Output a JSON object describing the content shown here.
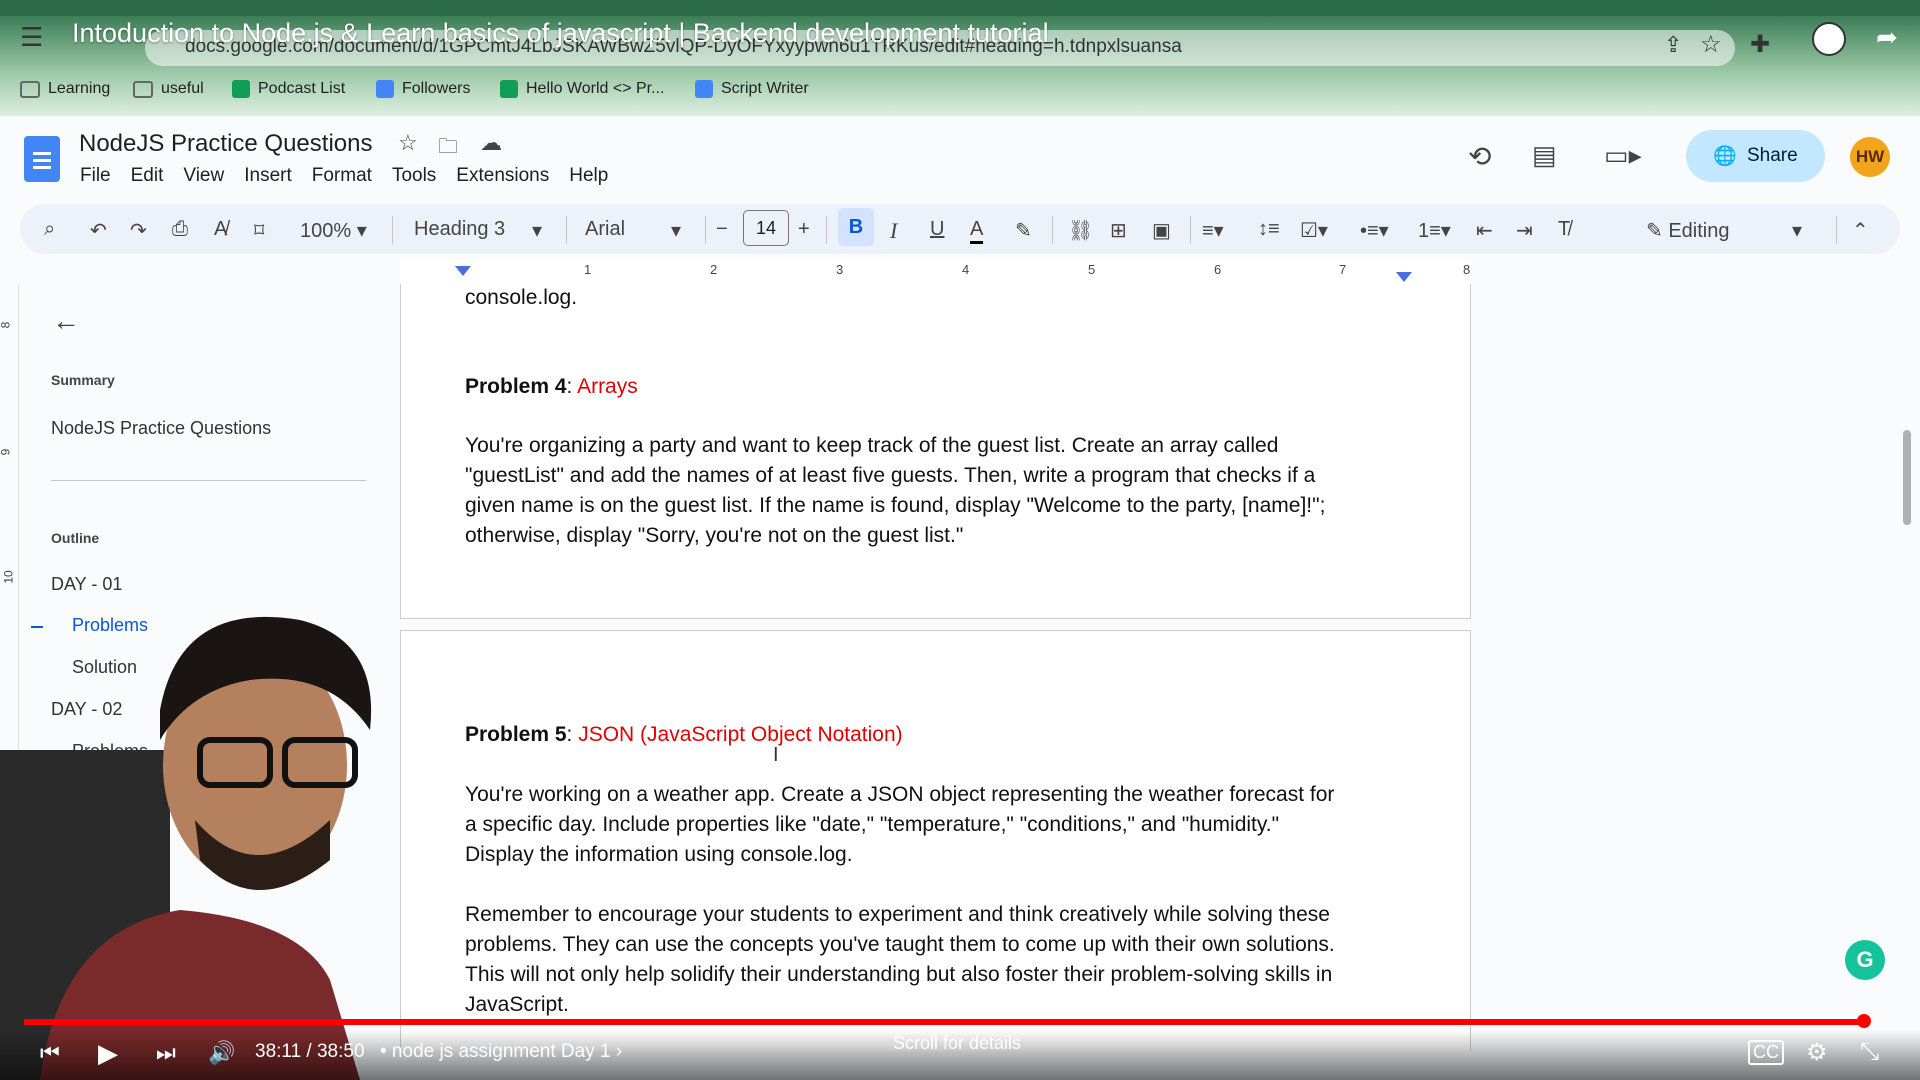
{
  "video": {
    "title": "Intoduction to Node.js & Learn basics of javascript | Backend development tutorial",
    "time": "38:11 / 38:50",
    "chapter": "• node js assignment Day 1 ›",
    "scroll_hint": "Scroll for details",
    "progress_fraction": 0.983
  },
  "browser": {
    "url": "docs.google.com/document/d/1GPCmtJ4LbJSKAWBwZ5vlQP-DyOFYxyypwn6u1TRKus/edit#heading=h.tdnpxlsuansa",
    "bookmarks": [
      {
        "label": "Learning",
        "color": "#7a7a7a"
      },
      {
        "label": "useful",
        "color": "#7a7a7a"
      },
      {
        "label": "Podcast List",
        "color": "#0f9d58"
      },
      {
        "label": "Followers",
        "color": "#4285f4"
      },
      {
        "label": "Hello World <> Pr...",
        "color": "#0f9d58"
      },
      {
        "label": "Script Writer",
        "color": "#4285f4"
      }
    ]
  },
  "docs": {
    "title": "NodeJS Practice Questions",
    "menu": [
      "File",
      "Edit",
      "View",
      "Insert",
      "Format",
      "Tools",
      "Extensions",
      "Help"
    ],
    "share_label": "Share",
    "avatar": "HW",
    "toolbar": {
      "zoom": "100%",
      "style": "Heading 3",
      "font": "Arial",
      "font_size": "14",
      "mode": "Editing"
    },
    "ruler_numbers": [
      "1",
      "2",
      "3",
      "4",
      "5",
      "6",
      "7",
      "8"
    ],
    "vruler_numbers": [
      "8",
      "9",
      "10"
    ]
  },
  "sidebar": {
    "summary_label": "Summary",
    "summary_text": "NodeJS Practice Questions",
    "outline_label": "Outline",
    "items": [
      {
        "label": "DAY - 01"
      },
      {
        "label": "Problems"
      },
      {
        "label": "Solution"
      },
      {
        "label": "DAY - 02"
      },
      {
        "label": "Problems"
      }
    ]
  },
  "document": {
    "p0": "console.log.",
    "prob4_label": "Problem 4",
    "prob4_topic": "Arrays",
    "prob4_lines": [
      "You're organizing a party and want to keep track of the guest list. Create an array called",
      "\"guestList\" and add the names of at least five guests. Then, write a program that checks if a",
      "given name is on the guest list. If the name is found, display \"Welcome to the party, [name]!\";",
      "otherwise, display \"Sorry, you're not on the guest list.\""
    ],
    "prob5_label": "Problem 5",
    "prob5_topic": "JSON (JavaScript Object Notation)",
    "prob5_lines": [
      "You're working on a weather app. Create a JSON object representing the weather forecast for",
      "a specific day. Include properties like \"date,\" \"temperature,\" \"conditions,\" and \"humidity.\"",
      "Display the information using console.log."
    ],
    "closing_lines": [
      "Remember to encourage your students to experiment and think creatively while solving these",
      "problems. They can use the concepts you've taught them to come up with their own solutions.",
      "This will not only help solidify their understanding but also foster their problem-solving skills in",
      "JavaScript."
    ]
  },
  "colors": {
    "accent": "#0b57d0",
    "heading_topic": "#e00000",
    "progress": "#ff0000"
  }
}
